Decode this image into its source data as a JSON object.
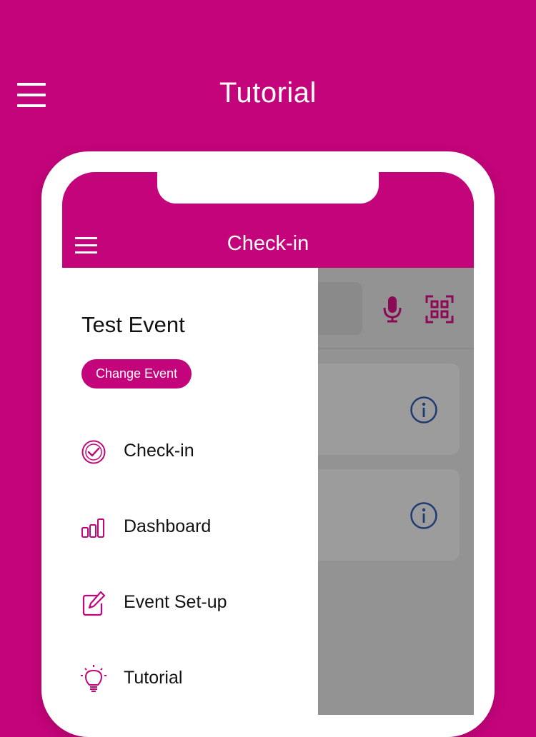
{
  "page": {
    "title": "Tutorial"
  },
  "app": {
    "header_title": "Check-in",
    "event_name": "Test Event",
    "change_event_label": "Change Event",
    "nav": [
      {
        "label": "Check-in",
        "icon": "check-circle-icon"
      },
      {
        "label": "Dashboard",
        "icon": "bar-chart-icon"
      },
      {
        "label": "Event Set-up",
        "icon": "edit-icon"
      },
      {
        "label": "Tutorial",
        "icon": "lightbulb-icon"
      }
    ]
  },
  "colors": {
    "brand": "#c4047a",
    "drawer_bg": "#ffffff",
    "overlay": "#939393",
    "info_icon": "#1f3b73"
  },
  "icons": {
    "top_menu": "hamburger-icon",
    "app_menu": "hamburger-icon",
    "search_bar": [
      "microphone-icon",
      "qr-scan-icon"
    ],
    "cards": "info-icon"
  }
}
